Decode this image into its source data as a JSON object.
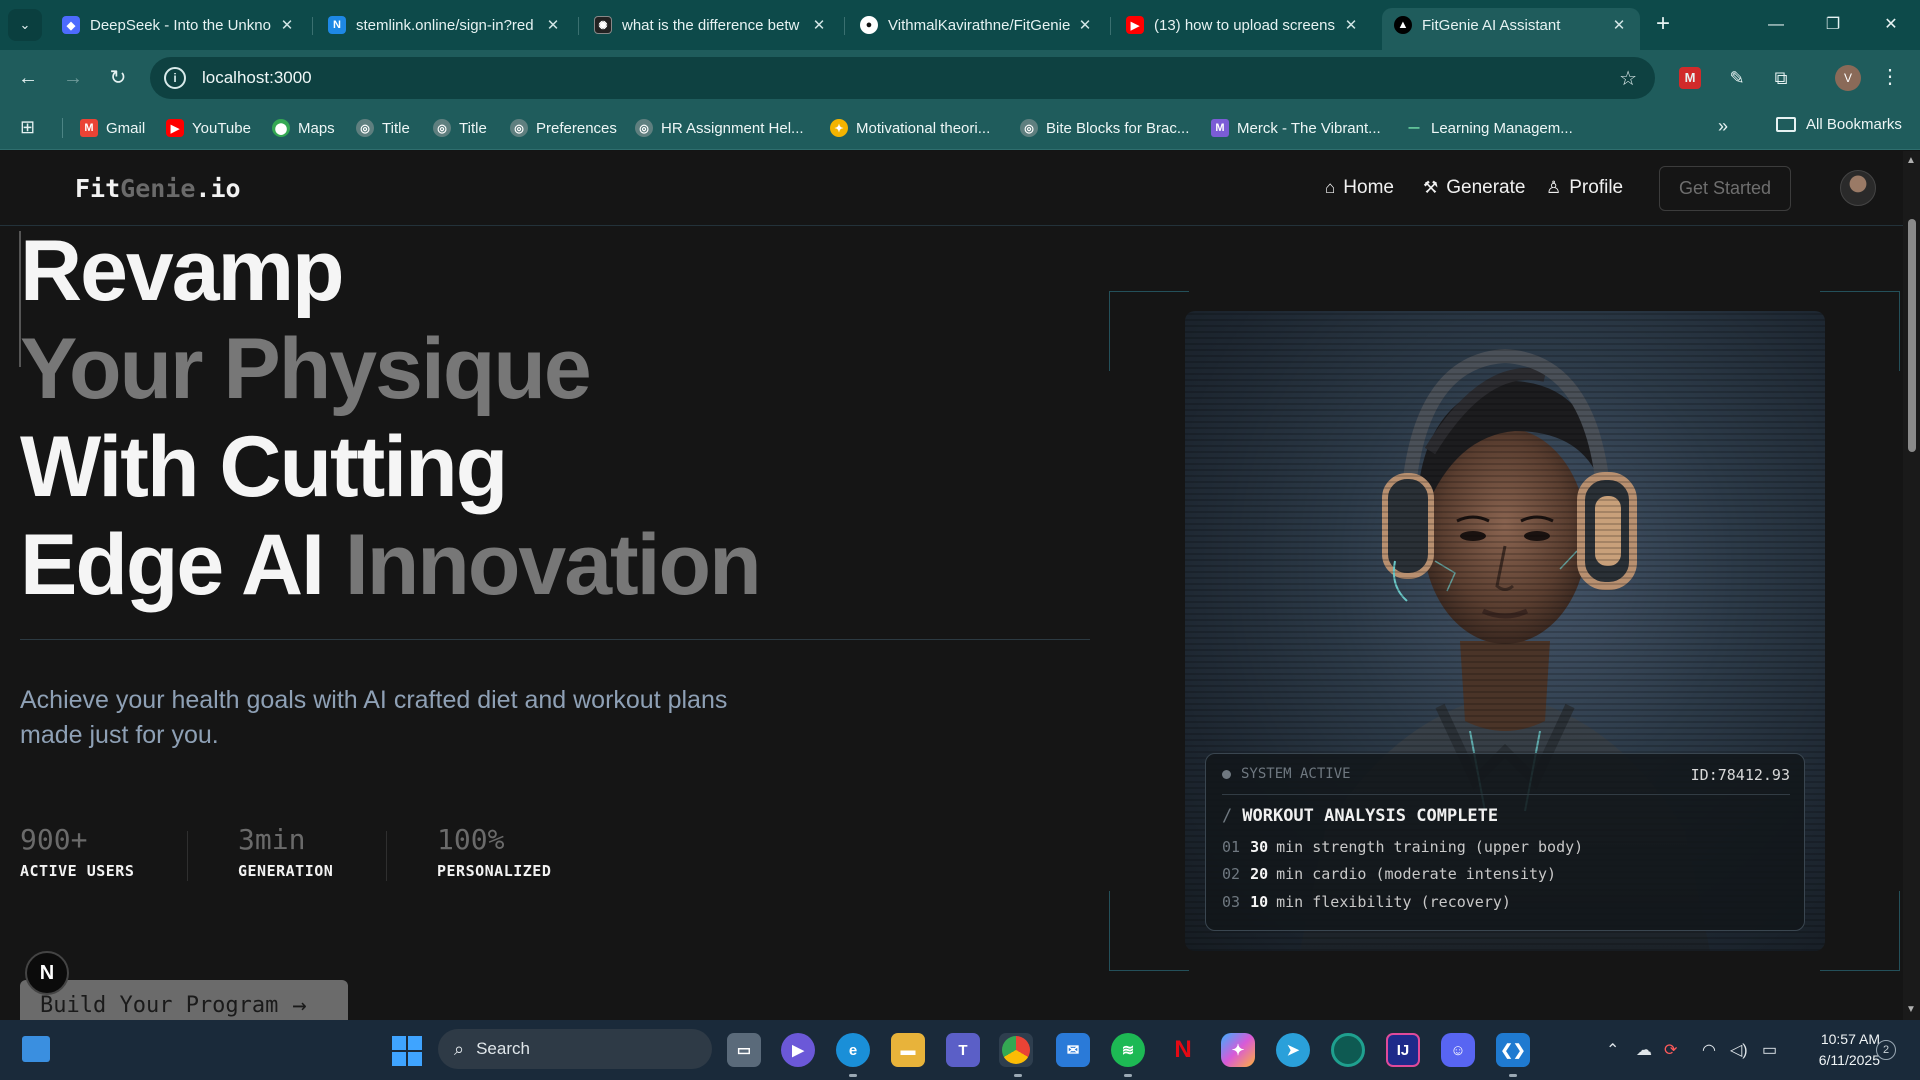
{
  "browser": {
    "tabs": [
      {
        "title": "DeepSeek - Into the Unkno",
        "favicon_color": "#4d6bfe",
        "active": false
      },
      {
        "title": "stemlink.online/sign-in?red",
        "favicon_color": "#1e88e5",
        "active": false
      },
      {
        "title": "what is the difference betw",
        "favicon_color": "#222222",
        "active": false
      },
      {
        "title": "VithmalKavirathne/FitGenie",
        "favicon_color": "#ffffff",
        "active": false
      },
      {
        "title": "(13) how to upload screens",
        "favicon_color": "#ff0000",
        "active": false
      },
      {
        "title": "FitGenie AI Assistant",
        "favicon_color": "#000000",
        "active": true
      }
    ],
    "url": "localhost:3000",
    "profile_initial": "V",
    "bookmarks": [
      {
        "label": "Gmail",
        "icon": "gmail-icon",
        "color": "#ea4335"
      },
      {
        "label": "YouTube",
        "icon": "youtube-icon",
        "color": "#ff0000"
      },
      {
        "label": "Maps",
        "icon": "maps-icon",
        "color": "#34a853"
      },
      {
        "label": "Title",
        "icon": "globe-icon",
        "color": "#5f7f7f"
      },
      {
        "label": "Title",
        "icon": "globe-icon",
        "color": "#5f7f7f"
      },
      {
        "label": "Preferences",
        "icon": "globe-icon",
        "color": "#5f7f7f"
      },
      {
        "label": "HR Assignment Hel...",
        "icon": "globe-icon",
        "color": "#5f7f7f"
      },
      {
        "label": "Motivational theori...",
        "icon": "sparkle-icon",
        "color": "#f4b400"
      },
      {
        "label": "Bite Blocks for Brac...",
        "icon": "globe-icon",
        "color": "#5f7f7f"
      },
      {
        "label": "Merck - The Vibrant...",
        "icon": "merck-icon",
        "color": "#7b5cd6"
      },
      {
        "label": "Learning Managem...",
        "icon": "lms-icon",
        "color": "#1f5c5c"
      }
    ],
    "all_bookmarks": "All Bookmarks"
  },
  "site": {
    "logo": {
      "part1": "Fit",
      "part2": "Genie",
      "part3": ".io"
    },
    "nav": [
      {
        "label": "Home",
        "icon": "home-icon"
      },
      {
        "label": "Generate",
        "icon": "dumbbell-icon"
      },
      {
        "label": "Profile",
        "icon": "user-icon"
      }
    ],
    "cta_label": "Get Started"
  },
  "hero": {
    "line1": "Revamp",
    "line2": "Your Physique",
    "line3": "With Cutting",
    "line4_a": "Edge AI",
    "line4_b": "Innovation",
    "subtitle": "Achieve your health goals with AI crafted diet and workout plans made just for you.",
    "stats": [
      {
        "value": "900+",
        "label": "ACTIVE USERS"
      },
      {
        "value": "3min",
        "label": "GENERATION"
      },
      {
        "value": "100%",
        "label": "PERSONALIZED"
      }
    ],
    "button": "Build Your Program",
    "next_badge": "N"
  },
  "card": {
    "status": "SYSTEM ACTIVE",
    "id": "ID:78412.93",
    "title": "WORKOUT ANALYSIS COMPLETE",
    "items": [
      {
        "num": "01",
        "qty": "30",
        "text": "min strength training (upper body)"
      },
      {
        "num": "02",
        "qty": "20",
        "text": "min cardio (moderate intensity)"
      },
      {
        "num": "03",
        "qty": "10",
        "text": "min flexibility (recovery)"
      }
    ]
  },
  "taskbar": {
    "search": "Search",
    "time": "10:57 AM",
    "date": "6/11/2025",
    "notifications": "2"
  }
}
